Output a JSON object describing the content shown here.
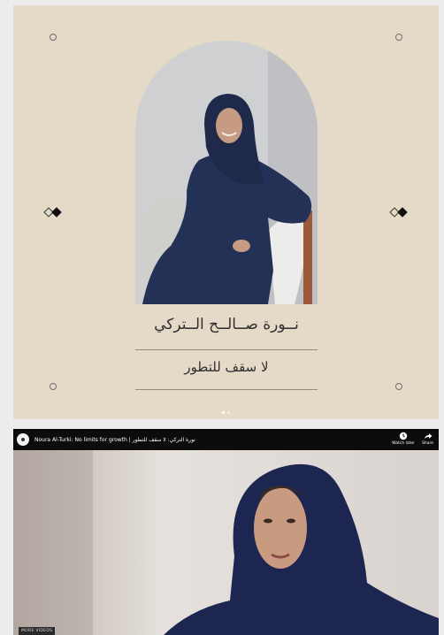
{
  "card": {
    "name_ar": "نــورة صــالــح الــتركي",
    "tagline_ar": "لا سقف للتطور",
    "carousel_dots": 2
  },
  "video": {
    "title": "Noura Al-Turki: No limits for growth | نورة التركي: لا سقف للتطور",
    "watch_later_label": "Watch later",
    "share_label": "Share",
    "more_videos_label": "MORE VIDEOS"
  },
  "colors": {
    "card_bg": "#e5dac8",
    "text": "#2f2f2f",
    "outfit": "#243156",
    "video_bar": "#0c0c0c"
  }
}
